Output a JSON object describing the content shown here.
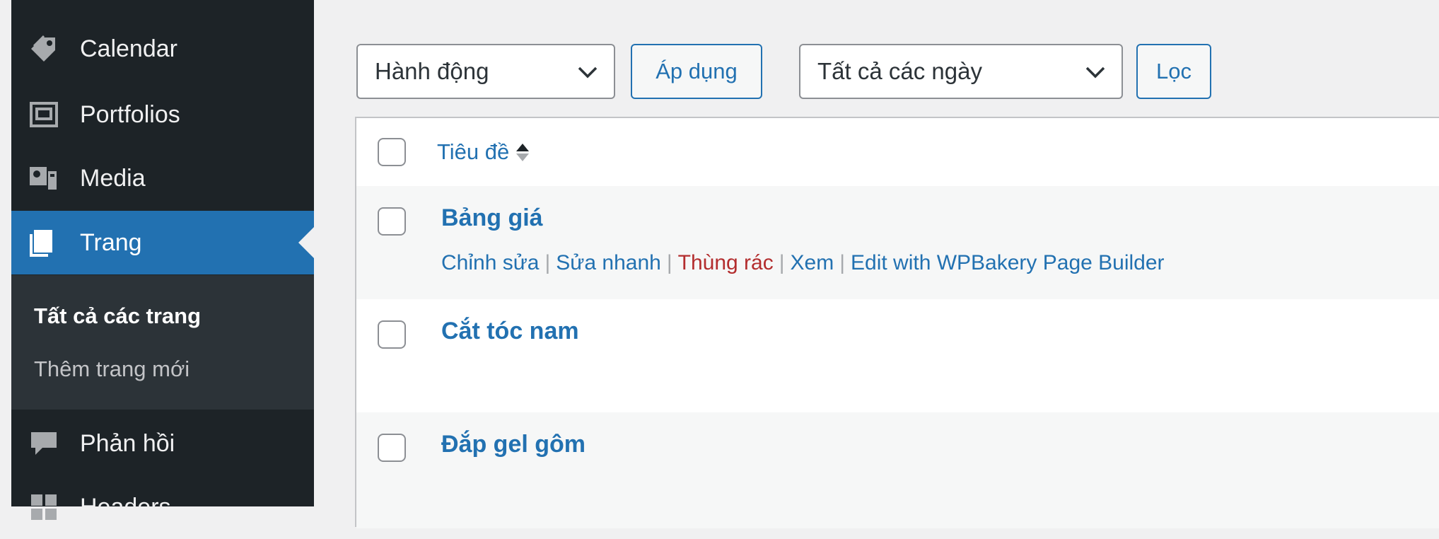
{
  "sidebar": {
    "items": [
      {
        "label": "Calendar",
        "icon": "tag-icon"
      },
      {
        "label": "Portfolios",
        "icon": "portfolio-icon"
      },
      {
        "label": "Media",
        "icon": "media-icon"
      },
      {
        "label": "Trang",
        "icon": "page-icon",
        "current": true
      },
      {
        "label": "Phản hồi",
        "icon": "comment-icon"
      },
      {
        "label": "Headers",
        "icon": "grid-icon"
      }
    ],
    "submenu": [
      {
        "label": "Tất cả các trang",
        "current": true
      },
      {
        "label": "Thêm trang mới"
      }
    ]
  },
  "filters": {
    "bulk_action": {
      "selected": "Hành động"
    },
    "apply_label": "Áp dụng",
    "date_filter": {
      "selected": "Tất cả các ngày"
    },
    "filter_label": "Lọc"
  },
  "table": {
    "column_title": "Tiêu đề",
    "rows": [
      {
        "title": "Bảng giá",
        "actions": [
          "Chỉnh sửa",
          "Sửa nhanh",
          "Thùng rác",
          "Xem",
          "Edit with WPBakery Page Builder"
        ]
      },
      {
        "title": "Cắt tóc nam"
      },
      {
        "title": "Đắp gel gôm"
      }
    ]
  },
  "colors": {
    "sidebar_bg": "#1d2327",
    "submenu_bg": "#2c3338",
    "accent": "#2271b1",
    "trash": "#b32d2e"
  }
}
